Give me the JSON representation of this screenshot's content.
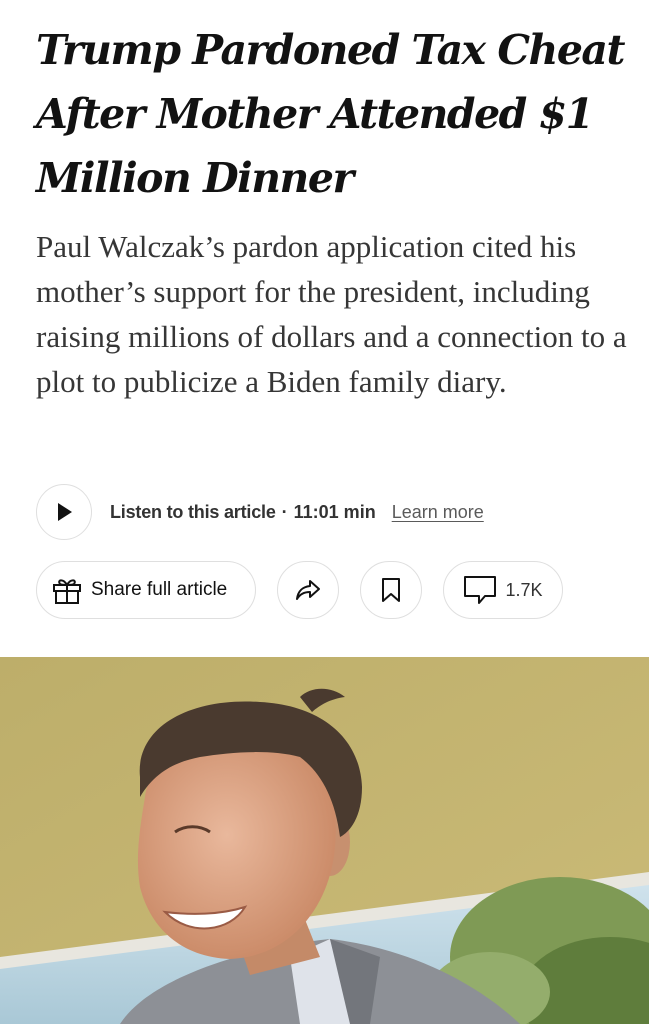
{
  "article": {
    "headline": "Trump Pardoned Tax Cheat After Mother Attended $1 Million Dinner",
    "summary": "Paul Walczak’s pardon application cited his mother’s support for the president, including raising millions of dollars and a connection to a plot to publicize a Biden family diary."
  },
  "audio": {
    "label": "Listen to this article",
    "separator": "·",
    "duration": "11:01 min",
    "learn_more": "Learn more",
    "play_icon": "play-icon"
  },
  "actions": {
    "share_full_label": "Share full article",
    "share_full_icon": "gift-icon",
    "share_icon": "share-arrow-icon",
    "save_icon": "bookmark-icon",
    "comments_icon": "comment-icon",
    "comments_count": "1.7K"
  },
  "colors": {
    "headline": "#121212",
    "summary": "#363636",
    "border": "#dfdfdf",
    "photo_wall": "#c3b26b"
  }
}
